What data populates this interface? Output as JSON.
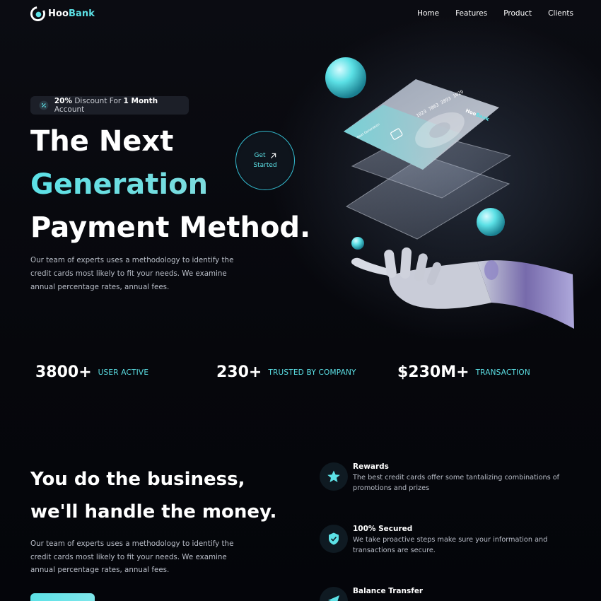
{
  "brand": {
    "name_part1": "Hoo",
    "name_part2": "Bank",
    "accent_color": "#5ce1e6"
  },
  "nav": {
    "items": [
      {
        "label": "Home"
      },
      {
        "label": "Features"
      },
      {
        "label": "Product"
      },
      {
        "label": "Clients"
      }
    ]
  },
  "hero": {
    "badge": {
      "percent": "20%",
      "text_before": "Discount For",
      "highlight": "1 Month",
      "text_after": "Account"
    },
    "title_line1": "The Next",
    "title_line2": "Generation",
    "title_line3": "Payment Method.",
    "cta_line1": "Get",
    "cta_line2": "Started",
    "description": "Our team of experts uses a methodology to identify the credit cards most likely to fit your needs. We examine annual percentage rates, annual fees."
  },
  "illustration": {
    "card_brand_part1": "Hoo",
    "card_brand_part2": "Bank",
    "card_number": "1023 7863 3893 1029",
    "card_name": "Next Generation"
  },
  "stats": [
    {
      "value": "3800+",
      "label": "User Active"
    },
    {
      "value": "230+",
      "label": "Trusted by Company"
    },
    {
      "value": "$230M+",
      "label": "Transaction"
    }
  ],
  "business": {
    "title_line1": "You do the business,",
    "title_line2": "we'll handle the money.",
    "description": "Our team of experts uses a methodology to identify the credit cards most likely to fit your needs. We examine annual percentage rates, annual fees."
  },
  "features": [
    {
      "icon": "star-icon",
      "title": "Rewards",
      "text": "The best credit cards offer some tantalizing combinations of promotions and prizes"
    },
    {
      "icon": "shield-icon",
      "title": "100% Secured",
      "text": "We take proactive steps make sure your information and transactions are secure."
    },
    {
      "icon": "send-icon",
      "title": "Balance Transfer",
      "text": ""
    }
  ]
}
